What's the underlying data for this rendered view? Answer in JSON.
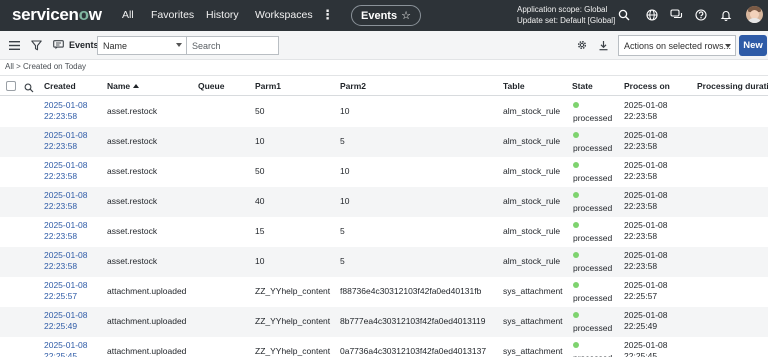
{
  "app": {
    "logo": {
      "pre": "servicen",
      "o": "o",
      "post": "w"
    },
    "nav": [
      "All",
      "Favorites",
      "History",
      "Workspaces"
    ],
    "current_tab": "Events",
    "scope_line1": "Application scope: Global",
    "scope_line2": "Update set: Default [Global]",
    "icons": [
      "search-icon",
      "globe-icon",
      "chat-icon",
      "help-icon",
      "bell-icon",
      "avatar"
    ]
  },
  "toolbar": {
    "title": "Events",
    "field_select": "Name",
    "search_placeholder": "Search",
    "actions_select": "Actions on selected rows...",
    "new_label": "New"
  },
  "breadcrumb": {
    "root": "All",
    "sep": ">",
    "filter": "Created on Today"
  },
  "table": {
    "columns": [
      "Created",
      "Name",
      "Queue",
      "Parm1",
      "Parm2",
      "Table",
      "State",
      "Process on",
      "Processing duration"
    ],
    "sort_column": "Name",
    "state_color": "#7ed36f",
    "rows": [
      {
        "created_date": "2025-01-08",
        "created_time": "22:23:58",
        "name": "asset.restock",
        "queue": "",
        "parm1": "50",
        "parm2": "10",
        "table": "alm_stock_rule",
        "state": "processed",
        "proc_date": "2025-01-08",
        "proc_time": "22:23:58"
      },
      {
        "created_date": "2025-01-08",
        "created_time": "22:23:58",
        "name": "asset.restock",
        "queue": "",
        "parm1": "10",
        "parm2": "5",
        "table": "alm_stock_rule",
        "state": "processed",
        "proc_date": "2025-01-08",
        "proc_time": "22:23:58"
      },
      {
        "created_date": "2025-01-08",
        "created_time": "22:23:58",
        "name": "asset.restock",
        "queue": "",
        "parm1": "50",
        "parm2": "10",
        "table": "alm_stock_rule",
        "state": "processed",
        "proc_date": "2025-01-08",
        "proc_time": "22:23:58"
      },
      {
        "created_date": "2025-01-08",
        "created_time": "22:23:58",
        "name": "asset.restock",
        "queue": "",
        "parm1": "40",
        "parm2": "10",
        "table": "alm_stock_rule",
        "state": "processed",
        "proc_date": "2025-01-08",
        "proc_time": "22:23:58"
      },
      {
        "created_date": "2025-01-08",
        "created_time": "22:23:58",
        "name": "asset.restock",
        "queue": "",
        "parm1": "15",
        "parm2": "5",
        "table": "alm_stock_rule",
        "state": "processed",
        "proc_date": "2025-01-08",
        "proc_time": "22:23:58"
      },
      {
        "created_date": "2025-01-08",
        "created_time": "22:23:58",
        "name": "asset.restock",
        "queue": "",
        "parm1": "10",
        "parm2": "5",
        "table": "alm_stock_rule",
        "state": "processed",
        "proc_date": "2025-01-08",
        "proc_time": "22:23:58"
      },
      {
        "created_date": "2025-01-08",
        "created_time": "22:25:57",
        "name": "attachment.uploaded",
        "queue": "",
        "parm1": "ZZ_YYhelp_content",
        "parm2": "f88736e4c30312103f42fa0ed40131fb",
        "table": "sys_attachment",
        "state": "processed",
        "proc_date": "2025-01-08",
        "proc_time": "22:25:57"
      },
      {
        "created_date": "2025-01-08",
        "created_time": "22:25:49",
        "name": "attachment.uploaded",
        "queue": "",
        "parm1": "ZZ_YYhelp_content",
        "parm2": "8b777ea4c30312103f42fa0ed4013119",
        "table": "sys_attachment",
        "state": "processed",
        "proc_date": "2025-01-08",
        "proc_time": "22:25:49"
      },
      {
        "created_date": "2025-01-08",
        "created_time": "22:25:45",
        "name": "attachment.uploaded",
        "queue": "",
        "parm1": "ZZ_YYhelp_content",
        "parm2": "0a7736a4c30312103f42fa0ed4013137",
        "table": "sys_attachment",
        "state": "processed",
        "proc_date": "2025-01-08",
        "proc_time": "22:25:45"
      }
    ]
  }
}
